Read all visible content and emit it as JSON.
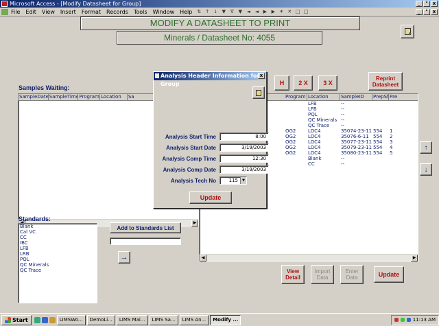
{
  "window": {
    "title": "Microsoft Access - [Modify Datasheet for Group]",
    "controls": [
      "_",
      "°",
      "x"
    ],
    "doc_controls": [
      "_",
      "°",
      "x"
    ]
  },
  "menu": {
    "items": [
      "File",
      "Edit",
      "View",
      "Insert",
      "Format",
      "Records",
      "Tools",
      "Window",
      "Help"
    ],
    "toolbar_glyphs": [
      "⇅",
      "↑",
      "↓",
      "▼",
      "∇",
      "▼",
      "◄",
      "◄",
      "▶",
      "▶",
      "✶",
      "✕",
      "□",
      "□"
    ]
  },
  "header": {
    "main_title": "MODIFY A DATASHEET TO PRINT",
    "sub_title": "Minerals / Datasheet No: 4055"
  },
  "samples": {
    "label": "Samples Waiting:",
    "columns": [
      "SampleDate",
      "SampleTime",
      "Program",
      "Location",
      "Sa"
    ]
  },
  "standards": {
    "label": "Standards:",
    "items": [
      "Blank",
      "Cal VC",
      "CC",
      "IBC",
      "LFB",
      "LRB",
      "PQL",
      "QC Minerals",
      "QC Trace"
    ],
    "add_button": "Add to Standards List",
    "input_value": "",
    "arrow": "→"
  },
  "nav": {
    "first": "H",
    "two_x": "2 X",
    "three_x": "3 X",
    "reprint": "Reprint Datasheet"
  },
  "datasheet": {
    "columns": [
      "Program",
      "Location",
      "SampleID",
      "PrepSht",
      "Pre"
    ],
    "rows": [
      [
        "",
        "LFB",
        "--",
        "",
        ""
      ],
      [
        "",
        "LFB",
        "--",
        "",
        ""
      ],
      [
        "",
        "PQL",
        "--",
        "",
        ""
      ],
      [
        "",
        "QC Minerals",
        "--",
        "",
        ""
      ],
      [
        "",
        "QC Trace",
        "--",
        "",
        ""
      ],
      [
        "OG2",
        "LOC4",
        "35074-23-11",
        "554",
        "1"
      ],
      [
        "OG2",
        "LOC4",
        "35076-6-11",
        "554",
        "2"
      ],
      [
        "OG2",
        "LOC4",
        "35077-23-11",
        "554",
        "3"
      ],
      [
        "OG2",
        "LOC4",
        "35079-23-11",
        "554",
        "4"
      ],
      [
        "OG2",
        "LOC4",
        "35080-23-11",
        "554",
        "5"
      ],
      [
        "",
        "Blank",
        "--",
        "",
        ""
      ],
      [
        "",
        "CC",
        "--",
        "",
        ""
      ]
    ],
    "up": "↑",
    "down": "↓"
  },
  "actions": {
    "view_detail": "View Detail",
    "import_data": "Import Data",
    "enter_data": "Enter Data",
    "update": "Update"
  },
  "dialog": {
    "title": "Analysis Header Information for Group",
    "fields": [
      {
        "label": "Analysis Start Time",
        "value": "8:00"
      },
      {
        "label": "Analysis Start Date",
        "value": "3/19/2003"
      },
      {
        "label": "Analysis Comp Time",
        "value": "12:30"
      },
      {
        "label": "Analysis Comp Date",
        "value": "3/19/2003"
      },
      {
        "label": "Analysis Tech No",
        "value": "115"
      }
    ],
    "update": "Update"
  },
  "taskbar": {
    "start": "Start",
    "tasks": [
      "LIMSWo...",
      "DemoLi...",
      "LIMS Mai...",
      "LIMS Sa...",
      "LIMS An...",
      "Modify ..."
    ],
    "clock": "11:13 AM"
  }
}
